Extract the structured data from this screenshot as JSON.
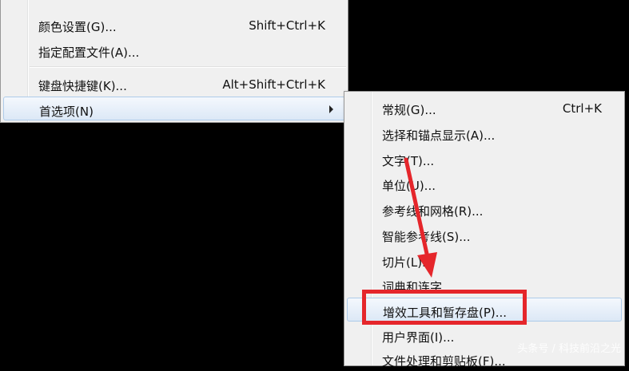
{
  "main_menu": {
    "items": [
      {
        "label": "颜色设置(G)...",
        "shortcut": "Shift+Ctrl+K"
      },
      {
        "label": "指定配置文件(A)...",
        "shortcut": ""
      },
      {
        "label": "键盘快捷键(K)...",
        "shortcut": "Alt+Shift+Ctrl+K"
      },
      {
        "label": "首选项(N)",
        "shortcut": "",
        "has_submenu": true
      }
    ]
  },
  "submenu": {
    "items": [
      {
        "label": "常规(G)...",
        "shortcut": "Ctrl+K"
      },
      {
        "label": "选择和锚点显示(A)..."
      },
      {
        "label": "文字(T)..."
      },
      {
        "label": "单位(U)..."
      },
      {
        "label": "参考线和网格(R)..."
      },
      {
        "label": "智能参考线(S)..."
      },
      {
        "label": "切片(L)..."
      },
      {
        "label": "词典和连字..."
      },
      {
        "label": "增效工具和暂存盘(P)..."
      },
      {
        "label": "用户界面(I)..."
      },
      {
        "label": "文件处理和剪贴板(F)..."
      }
    ]
  },
  "watermark": "头条号 / 科技前沿之光",
  "colors": {
    "background": "#000000",
    "menu_bg": "#f0f0f0",
    "highlight_red": "#e5262b",
    "hover_blue": "#dce8f6"
  }
}
